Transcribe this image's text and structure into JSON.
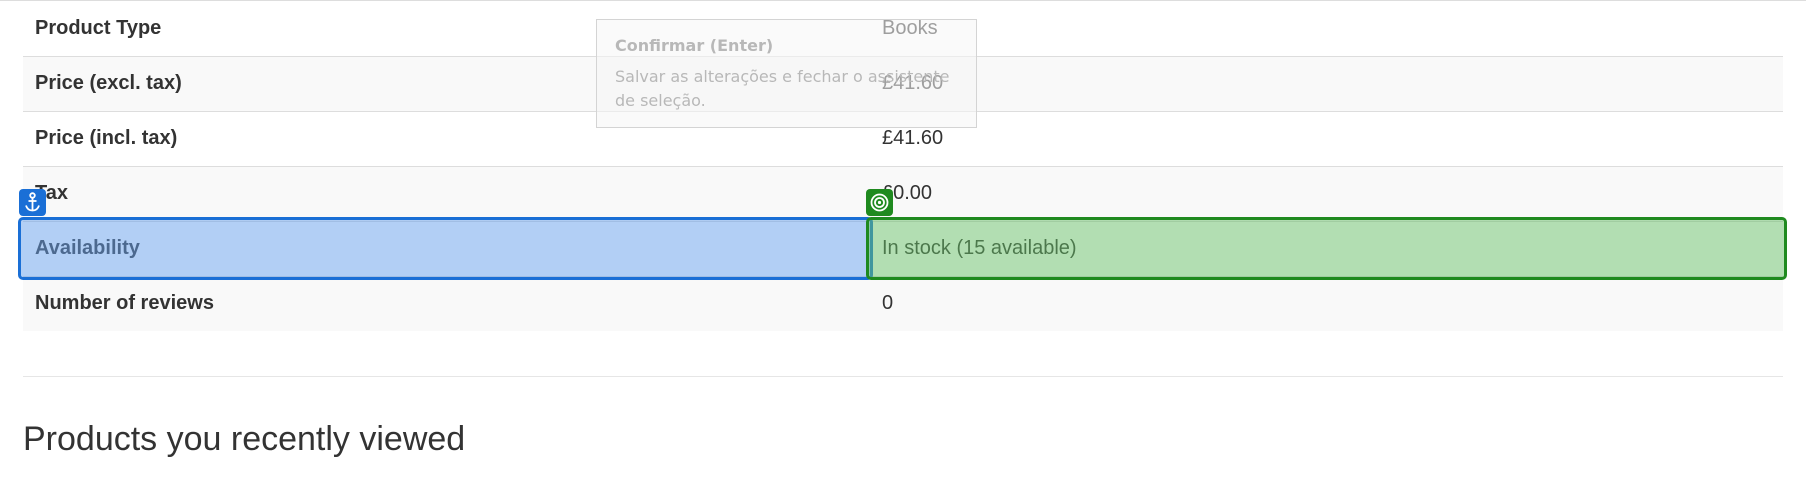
{
  "product_info": {
    "rows": [
      {
        "key": "Product Type",
        "value": "Books"
      },
      {
        "key": "Price (excl. tax)",
        "value": "£41.60"
      },
      {
        "key": "Price (incl. tax)",
        "value": "£41.60"
      },
      {
        "key": "Tax",
        "value": "£0.00"
      },
      {
        "key": "Availability",
        "value": "In stock (15 available)"
      },
      {
        "key": "Number of reviews",
        "value": "0"
      }
    ]
  },
  "selection": {
    "anchor_icon": "anchor-icon",
    "target_icon": "target-icon",
    "anchor_color": "#1a6fd6",
    "target_color": "#1f8a1f"
  },
  "tooltip": {
    "title": "Confirmar (Enter)",
    "body": "Salvar as alterações e fechar o assistente de seleção."
  },
  "recently_viewed": {
    "heading": "Products you recently viewed"
  }
}
